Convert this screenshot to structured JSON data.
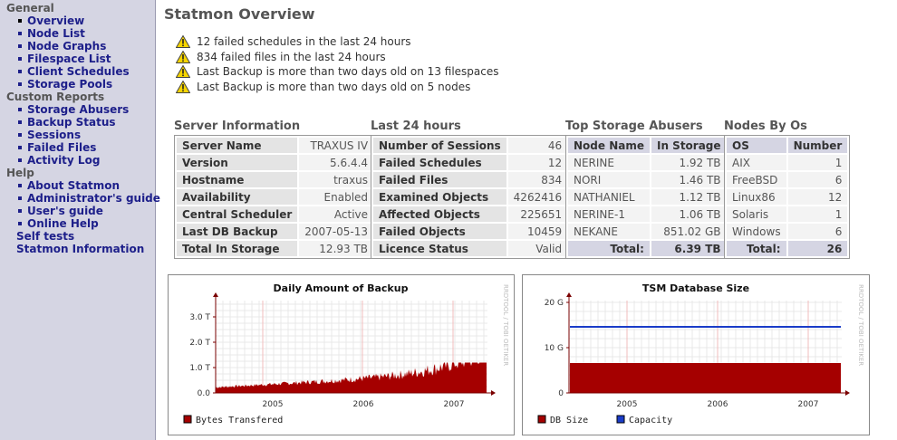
{
  "sidebar": {
    "general": {
      "label": "General",
      "items": [
        {
          "label": "Overview",
          "active": true
        },
        {
          "label": "Node List"
        },
        {
          "label": "Node Graphs"
        },
        {
          "label": "Filespace List"
        },
        {
          "label": "Client Schedules"
        },
        {
          "label": "Storage Pools"
        }
      ]
    },
    "custom_reports": {
      "label": "Custom Reports",
      "items": [
        {
          "label": "Storage Abusers"
        },
        {
          "label": "Backup Status"
        },
        {
          "label": "Sessions"
        },
        {
          "label": "Failed Files"
        },
        {
          "label": "Activity Log"
        }
      ]
    },
    "help": {
      "label": "Help",
      "items": [
        {
          "label": "About Statmon"
        },
        {
          "label": "Administrator's guide"
        },
        {
          "label": "User's guide"
        },
        {
          "label": "Online Help"
        }
      ]
    },
    "self_tests": "Self tests",
    "statmon_information": "Statmon Information"
  },
  "page_title": "Statmon Overview",
  "alerts": [
    "12 failed schedules in the last 24 hours",
    "834 failed files in the last 24 hours",
    "Last Backup is more than two days old on 13 filespaces",
    "Last Backup is more than two days old on 5 nodes"
  ],
  "server_info": {
    "title": "Server Information",
    "rows": [
      {
        "k": "Server Name",
        "v": "TRAXUS IV"
      },
      {
        "k": "Version",
        "v": "5.6.4.4"
      },
      {
        "k": "Hostname",
        "v": "traxus"
      },
      {
        "k": "Availability",
        "v": "Enabled"
      },
      {
        "k": "Central Scheduler",
        "v": "Active"
      },
      {
        "k": "Last DB Backup",
        "v": "2007-05-13"
      },
      {
        "k": "Total In Storage",
        "v": "12.93 TB"
      }
    ]
  },
  "last24": {
    "title": "Last 24 hours",
    "rows": [
      {
        "k": "Number of Sessions",
        "v": "46"
      },
      {
        "k": "Failed Schedules",
        "v": "12"
      },
      {
        "k": "Failed Files",
        "v": "834"
      },
      {
        "k": "Examined Objects",
        "v": "4262416"
      },
      {
        "k": "Affected Objects",
        "v": "225651"
      },
      {
        "k": "Failed Objects",
        "v": "10459"
      },
      {
        "k": "Licence Status",
        "v": "Valid"
      }
    ]
  },
  "abusers": {
    "title": "Top Storage Abusers",
    "headers": [
      "Node Name",
      "In Storage"
    ],
    "rows": [
      {
        "k": "NERINE",
        "v": "1.92 TB"
      },
      {
        "k": "NORI",
        "v": "1.46 TB"
      },
      {
        "k": "NATHANIEL",
        "v": "1.12 TB"
      },
      {
        "k": "NERINE-1",
        "v": "1.06 TB"
      },
      {
        "k": "NEKANE",
        "v": "851.02 GB"
      }
    ],
    "total_label": "Total:",
    "total_value": "6.39 TB"
  },
  "nodes_by_os": {
    "title": "Nodes By Os",
    "headers": [
      "OS",
      "Number"
    ],
    "rows": [
      {
        "k": "AIX",
        "v": "1"
      },
      {
        "k": "FreeBSD",
        "v": "6"
      },
      {
        "k": "Linux86",
        "v": "12"
      },
      {
        "k": "Solaris",
        "v": "1"
      },
      {
        "k": "Windows",
        "v": "6"
      }
    ],
    "total_label": "Total:",
    "total_value": "26"
  },
  "graph_backup": {
    "title": "Daily Amount of Backup",
    "y_ticks": [
      "3.0 T",
      "2.0 T",
      "1.0 T",
      "0.0"
    ],
    "x_ticks": [
      "2005",
      "2006",
      "2007"
    ],
    "legend": "Bytes Transfered",
    "watermark": "RRDTOOL / TOBI OETIKER",
    "color": "#a50000"
  },
  "graph_db": {
    "title": "TSM Database Size",
    "y_ticks": [
      "20 G",
      "10 G",
      "0"
    ],
    "x_ticks": [
      "2005",
      "2006",
      "2007"
    ],
    "legend_db": "DB Size",
    "legend_capacity": "Capacity",
    "watermark": "RRDTOOL / TOBI OETIKER",
    "db_color": "#a50000",
    "capacity_color": "#1a3cc8"
  }
}
